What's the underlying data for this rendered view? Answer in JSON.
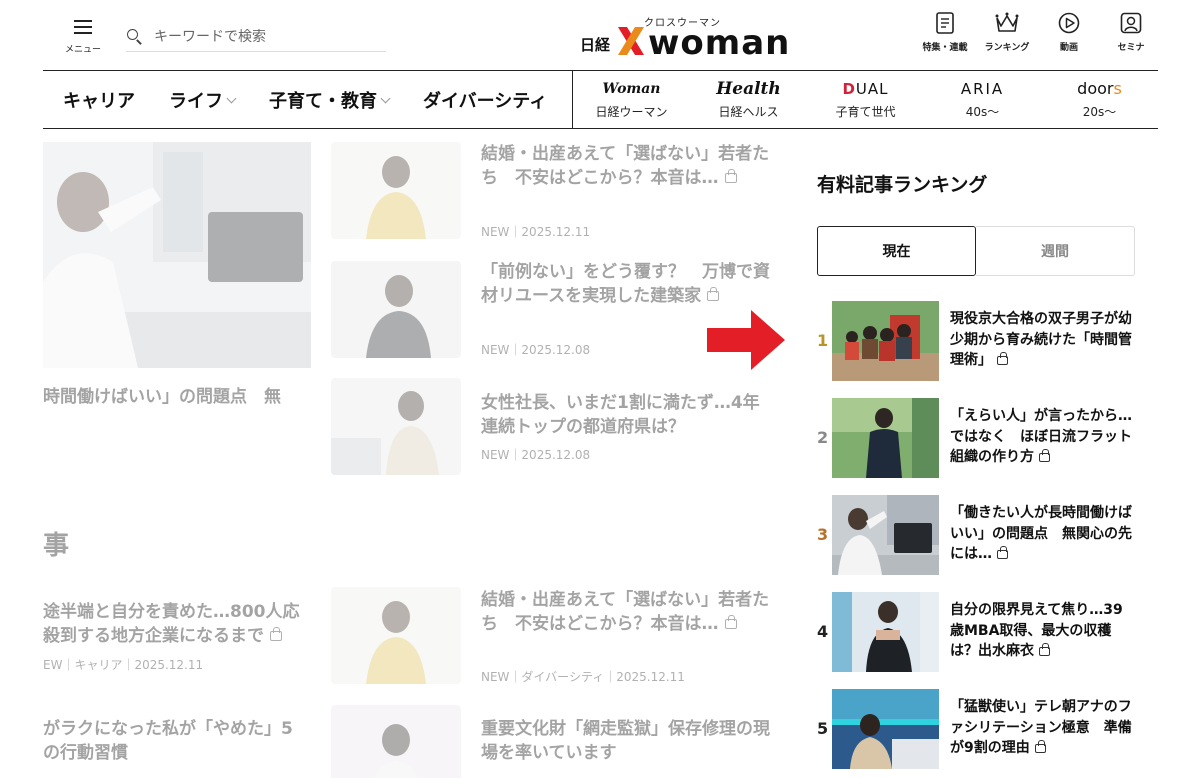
{
  "header": {
    "menu_label": "メニュー",
    "search_placeholder": "キーワードで検索",
    "logo": {
      "nikkei": "日経",
      "ruby": "クロスウーマン",
      "woman": "woman"
    },
    "links": [
      {
        "label": "特集・連載",
        "icon": "document-icon"
      },
      {
        "label": "ランキング",
        "icon": "crown-icon"
      },
      {
        "label": "動画",
        "icon": "play-icon"
      },
      {
        "label": "セミナ",
        "icon": "seminar-icon"
      }
    ]
  },
  "nav": {
    "categories": [
      {
        "label": "キャリア",
        "dropdown": false
      },
      {
        "label": "ライフ",
        "dropdown": true
      },
      {
        "label": "子育て・教育",
        "dropdown": true
      },
      {
        "label": "ダイバーシティ",
        "dropdown": false
      }
    ],
    "brands": [
      {
        "logo": "Woman",
        "sub": "日経ウーマン"
      },
      {
        "logo": "Health",
        "sub": "日経ヘルス"
      },
      {
        "logo": "DUAL",
        "sub": "子育て世代"
      },
      {
        "logo": "ARIA",
        "sub": "40s〜"
      },
      {
        "logo": "doors",
        "sub": "20s〜"
      }
    ]
  },
  "faded": {
    "hero_title": "時間働けばいい」の問題点　無",
    "section_heading": "事",
    "cards": [
      {
        "title": "結婚・出産あえて「選ばない」若者たち　不安はどこから？本音は…",
        "meta": "NEW｜2025.12.11"
      },
      {
        "title": "「前例ない」をどう覆す？　万博で資材リユースを実現した建築家",
        "meta": "NEW｜2025.12.08"
      },
      {
        "title": "女性社長、いまだ1割に満たず…4年連続トップの都道府県は？",
        "meta": "NEW｜2025.12.08"
      },
      {
        "title": "結婚・出産あえて「選ばない」若者たち　不安はどこから？本音は…",
        "meta": "NEW｜ダイバーシティ｜2025.12.11"
      },
      {
        "title": "重要文化財「網走監獄」保存修理の現場を率いています",
        "meta": ""
      }
    ],
    "lower_left": [
      {
        "line1": "途半端と自分を責めた…800人応",
        "line2": "殺到する地方企業になるまで",
        "meta": "EW｜キャリア｜2025.12.11"
      },
      {
        "line1": "がラクになった私が「やめた」5",
        "line2": "の行動習慣",
        "meta": ""
      }
    ]
  },
  "ranking": {
    "title": "有料記事ランキング",
    "tabs": [
      "現在",
      "週間"
    ],
    "items": [
      {
        "rank": "1",
        "title": "現役京大合格の双子男子が幼少期から育み続けた「時間管理術」",
        "rank_color": "#b8952b"
      },
      {
        "rank": "2",
        "title": "「えらい人」が言ったから…ではなく　ほぼ日流フラット組織の作り方",
        "rank_color": "#888888"
      },
      {
        "rank": "3",
        "title": "「働きたい人が長時間働けばいい」の問題点　無関心の先には…",
        "rank_color": "#b8732b"
      },
      {
        "rank": "4",
        "title": "自分の限界見えて焦り…39歳MBA取得、最大の収穫は？出水麻衣",
        "rank_color": "#222222"
      },
      {
        "rank": "5",
        "title": "「猛獣使い」テレ朝アナのファシリテーション極意　準備が9割の理由",
        "rank_color": "#222222"
      }
    ]
  },
  "colors": {
    "accent_red": "#e41e26",
    "logo_orange": "#e98a1a",
    "brand_dark": "#111111"
  }
}
